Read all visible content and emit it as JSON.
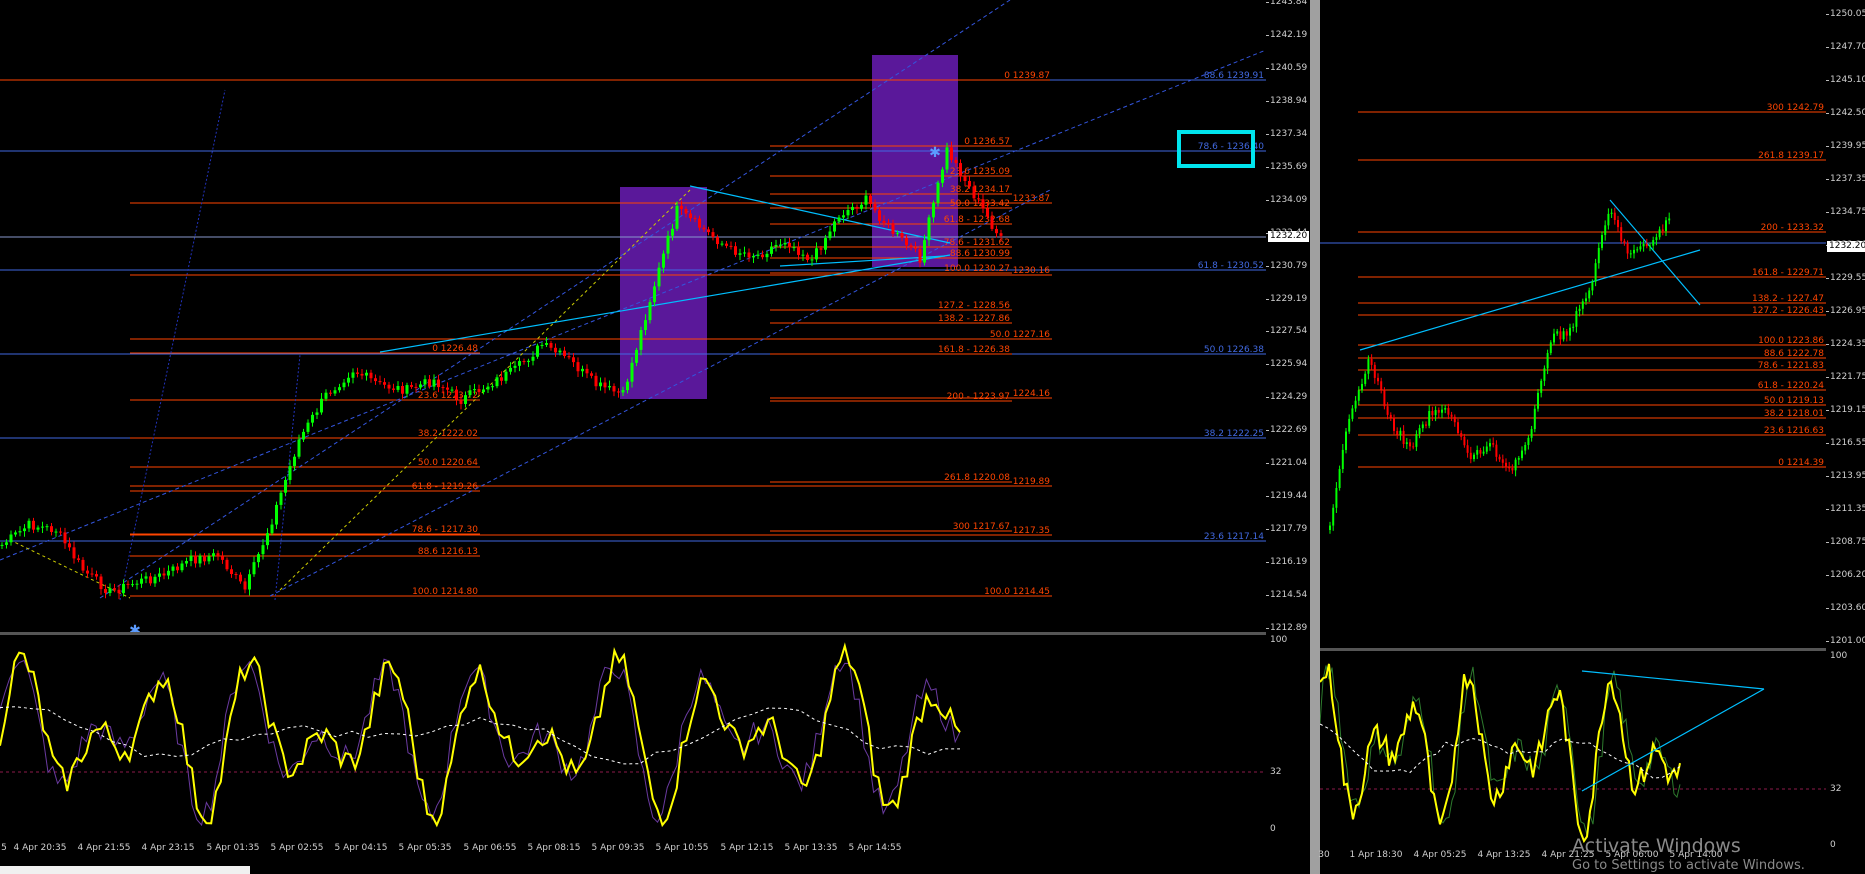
{
  "left": {
    "price_axis": [
      "1243.84",
      "1242.19",
      "1240.59",
      "1238.94",
      "1237.34",
      "1235.69",
      "1234.09",
      "1232.44",
      "1230.79",
      "1229.19",
      "1227.54",
      "1225.94",
      "1224.29",
      "1222.69",
      "1221.04",
      "1219.44",
      "1217.79",
      "1216.19",
      "1214.54",
      "1212.89"
    ],
    "current_price": "1232.20",
    "time_axis": [
      "5",
      "4 Apr 20:35",
      "4 Apr 21:55",
      "4 Apr 23:15",
      "5 Apr 01:35",
      "5 Apr 02:55",
      "5 Apr 04:15",
      "5 Apr 05:35",
      "5 Apr 06:55",
      "5 Apr 08:15",
      "5 Apr 09:35",
      "5 Apr 10:55",
      "5 Apr 12:15",
      "5 Apr 13:35",
      "5 Apr 14:55"
    ],
    "osc_axis": [
      "100",
      "32",
      "0"
    ],
    "fib_labels": {
      "top": [
        "0 1239.87"
      ],
      "blue_right": [
        "88.6 1239.91",
        "78.6 - 1236.40",
        "61.8 - 1230.52",
        "50.0 1226.38",
        "38.2 1222.25",
        "23.6 1217.14"
      ],
      "set_a": [
        "0 1226.48",
        "23.6 1223.72",
        "38.2 1222.02",
        "50.0 1220.64",
        "61.8 - 1219.26",
        "78.6 - 1217.30",
        "88.6 1216.13",
        "100.0 1214.80"
      ],
      "set_b": [
        "0 1236.57",
        "23.6 1235.09",
        "38.2 1234.17",
        "50.0 1233.42",
        "61.8 - 1232.68",
        "78.6 - 1231.62",
        "88.6 1230.99",
        "100.0 1230.27"
      ],
      "set_c": [
        "1233.87",
        "1230.16",
        "127.2 - 1228.56",
        "138.2 - 1227.86",
        "50.0 1227.16",
        "161.8 - 1226.38",
        "200 - 1223.97",
        "1224.16",
        "261.8 1220.08",
        "1219.89",
        "300 1217.67",
        "1217.35",
        "100.0 1214.45"
      ]
    }
  },
  "right": {
    "price_axis": [
      "1250.05",
      "1247.70",
      "1245.10",
      "1242.50",
      "1239.95",
      "1237.35",
      "1234.75",
      "1232.20",
      "1229.55",
      "1226.95",
      "1224.35",
      "1221.75",
      "1219.15",
      "1216.55",
      "1213.95",
      "1211.35",
      "1208.75",
      "1206.20",
      "1203.60",
      "1201.00"
    ],
    "current_price": "1232.20",
    "time_axis": [
      "30",
      "1 Apr 18:30",
      "4 Apr 05:25",
      "4 Apr 13:25",
      "4 Apr 21:25",
      "5 Apr 06:00",
      "5 Apr 14:00"
    ],
    "osc_axis": [
      "100",
      "32",
      "0"
    ],
    "fib_labels": [
      "300 1242.79",
      "261.8 1239.17",
      "200 - 1233.32",
      "161.8 - 1229.71",
      "138.2 - 1227.47",
      "127.2 - 1226.43",
      "100.0 1223.86",
      "88.6 1222.78",
      "78.6 - 1221.83",
      "61.8 - 1220.24",
      "50.0 1219.13",
      "38.2 1218.01",
      "23.6 1216.63",
      "0 1214.39"
    ]
  },
  "watermark": {
    "title": "Activate Windows",
    "subtitle": "Go to Settings to activate Windows."
  },
  "colors": {
    "background": "#000000",
    "candle_up": "#00ff00",
    "candle_down": "#ff0000",
    "fib_orange": "#ff4500",
    "fib_blue": "#4169e1",
    "trendline": "#00bfff",
    "zone_purple": "#5a189a",
    "osc_main": "#ffff00",
    "osc_signal": "#ffffff",
    "highlight": "#00e5ee"
  }
}
